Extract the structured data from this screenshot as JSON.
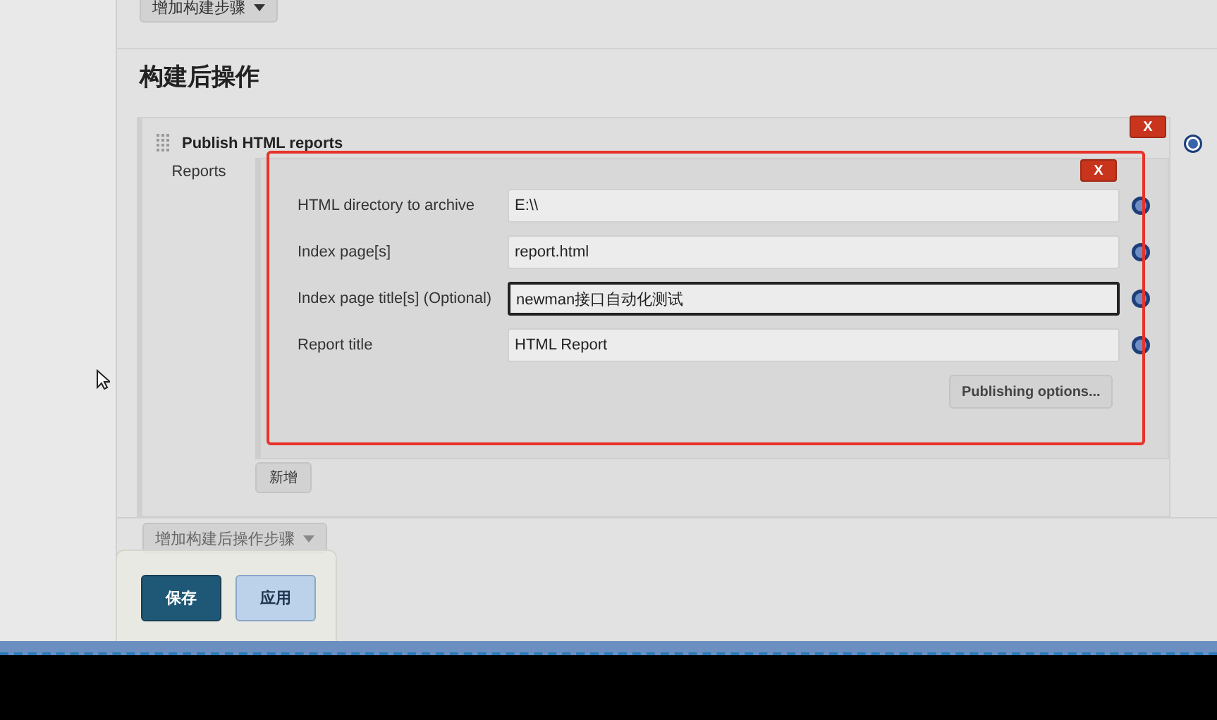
{
  "top_button": {
    "label": "增加构建步骤"
  },
  "section_title": "构建后操作",
  "publisher": {
    "title": "Publish HTML reports",
    "delete_label": "X",
    "reports_label": "Reports",
    "report": {
      "delete_label": "X",
      "fields": [
        {
          "label": "HTML directory to archive",
          "value": "E:\\\\",
          "focused": false
        },
        {
          "label": "Index page[s]",
          "value": "report.html",
          "focused": false
        },
        {
          "label": "Index page title[s] (Optional)",
          "value": "newman接口自动化测试",
          "focused": true
        },
        {
          "label": "Report title",
          "value": "HTML Report",
          "focused": false
        }
      ],
      "options_button": "Publishing options..."
    },
    "add_button": "新增"
  },
  "add_post_build_button": {
    "label": "增加构建后操作步骤"
  },
  "save_bar": {
    "save": "保存",
    "apply": "应用"
  }
}
